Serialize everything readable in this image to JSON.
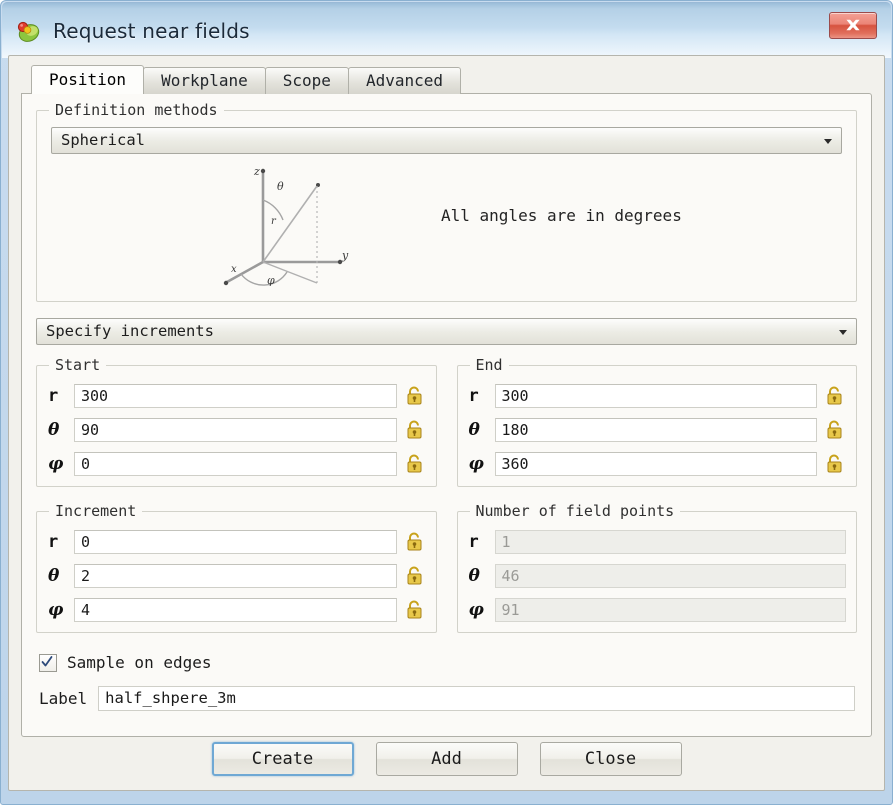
{
  "window": {
    "title": "Request near fields",
    "app_icon": "fields-icon",
    "close_label": "close-icon"
  },
  "tabs": [
    {
      "label": "Position",
      "active": true
    },
    {
      "label": "Workplane",
      "active": false
    },
    {
      "label": "Scope",
      "active": false
    },
    {
      "label": "Advanced",
      "active": false
    }
  ],
  "definition": {
    "group_title": "Definition methods",
    "method_value": "Spherical",
    "angles_note": "All angles are in degrees",
    "diagram": {
      "z_label": "z",
      "y_label": "y",
      "x_label": "x",
      "theta_label": "θ",
      "r_label": "r",
      "phi_label": "φ"
    }
  },
  "increments_mode": {
    "value": "Specify increments"
  },
  "groups": {
    "start": {
      "title": "Start",
      "fields": [
        {
          "symbol": "r",
          "symbol_style": "plain",
          "value": "300",
          "disabled": false,
          "lock": "lock-open-icon"
        },
        {
          "symbol": "θ",
          "symbol_style": "greek",
          "value": "90",
          "disabled": false,
          "lock": "lock-open-icon"
        },
        {
          "symbol": "φ",
          "symbol_style": "greek",
          "value": "0",
          "disabled": false,
          "lock": "lock-open-icon"
        }
      ]
    },
    "end": {
      "title": "End",
      "fields": [
        {
          "symbol": "r",
          "symbol_style": "plain",
          "value": "300",
          "disabled": false,
          "lock": "lock-open-icon"
        },
        {
          "symbol": "θ",
          "symbol_style": "greek",
          "value": "180",
          "disabled": false,
          "lock": "lock-open-icon"
        },
        {
          "symbol": "φ",
          "symbol_style": "greek",
          "value": "360",
          "disabled": false,
          "lock": "lock-open-icon"
        }
      ]
    },
    "increment": {
      "title": "Increment",
      "fields": [
        {
          "symbol": "r",
          "symbol_style": "plain",
          "value": "0",
          "disabled": false,
          "lock": "lock-open-icon"
        },
        {
          "symbol": "θ",
          "symbol_style": "greek",
          "value": "2",
          "disabled": false,
          "lock": "lock-open-icon"
        },
        {
          "symbol": "φ",
          "symbol_style": "greek",
          "value": "4",
          "disabled": false,
          "lock": "lock-open-icon"
        }
      ]
    },
    "count": {
      "title": "Number of field points",
      "fields": [
        {
          "symbol": "r",
          "symbol_style": "plain",
          "value": "1",
          "disabled": true,
          "lock": null
        },
        {
          "symbol": "θ",
          "symbol_style": "greek",
          "value": "46",
          "disabled": true,
          "lock": null
        },
        {
          "symbol": "φ",
          "symbol_style": "greek",
          "value": "91",
          "disabled": true,
          "lock": null
        }
      ]
    }
  },
  "sample_on_edges": {
    "label": "Sample on edges",
    "checked": true
  },
  "label_field": {
    "label": "Label",
    "value": "half_shpere_3m"
  },
  "buttons": [
    {
      "label": "Create",
      "default": true
    },
    {
      "label": "Add",
      "default": false
    },
    {
      "label": "Close",
      "default": false
    }
  ],
  "colors": {
    "title_bar_top": "#96b6d4",
    "title_bar_bottom": "#f2f8fd",
    "frame": "#c9dcef",
    "dialog_body": "#f2f1ec",
    "tab_panel": "#fbfaf7",
    "close_red": "#d6523f",
    "default_button_border": "#6fa8d4",
    "lock_gold": "#d9b833"
  }
}
